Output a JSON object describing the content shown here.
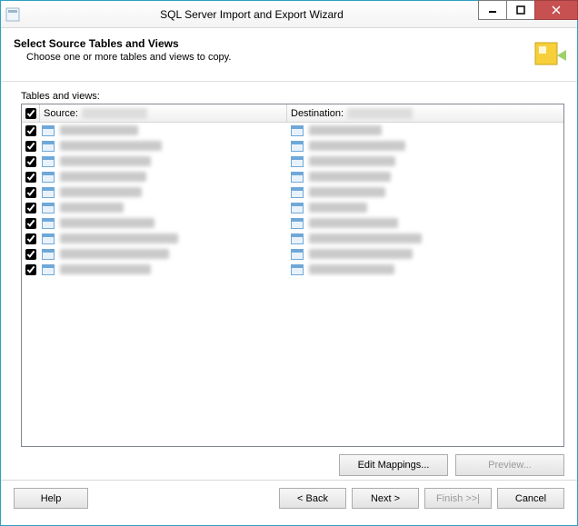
{
  "window": {
    "title": "SQL Server Import and Export Wizard"
  },
  "header": {
    "heading": "Select Source Tables and Views",
    "subheading": "Choose one or more tables and views to copy."
  },
  "grid": {
    "label": "Tables and views:",
    "col_source": "Source:",
    "col_destination": "Destination:",
    "header_checked": true,
    "rows": [
      {
        "checked": true,
        "src_w": 86,
        "dst_w": 80
      },
      {
        "checked": true,
        "src_w": 112,
        "dst_w": 106
      },
      {
        "checked": true,
        "src_w": 100,
        "dst_w": 95
      },
      {
        "checked": true,
        "src_w": 95,
        "dst_w": 90
      },
      {
        "checked": true,
        "src_w": 90,
        "dst_w": 84
      },
      {
        "checked": true,
        "src_w": 70,
        "dst_w": 64
      },
      {
        "checked": true,
        "src_w": 104,
        "dst_w": 98
      },
      {
        "checked": true,
        "src_w": 130,
        "dst_w": 124
      },
      {
        "checked": true,
        "src_w": 120,
        "dst_w": 114
      },
      {
        "checked": true,
        "src_w": 100,
        "dst_w": 94
      }
    ]
  },
  "mid": {
    "edit_mappings": "Edit Mappings...",
    "preview": "Preview..."
  },
  "footer": {
    "help": "Help",
    "back": "< Back",
    "next": "Next >",
    "finish": "Finish >>|",
    "cancel": "Cancel"
  }
}
